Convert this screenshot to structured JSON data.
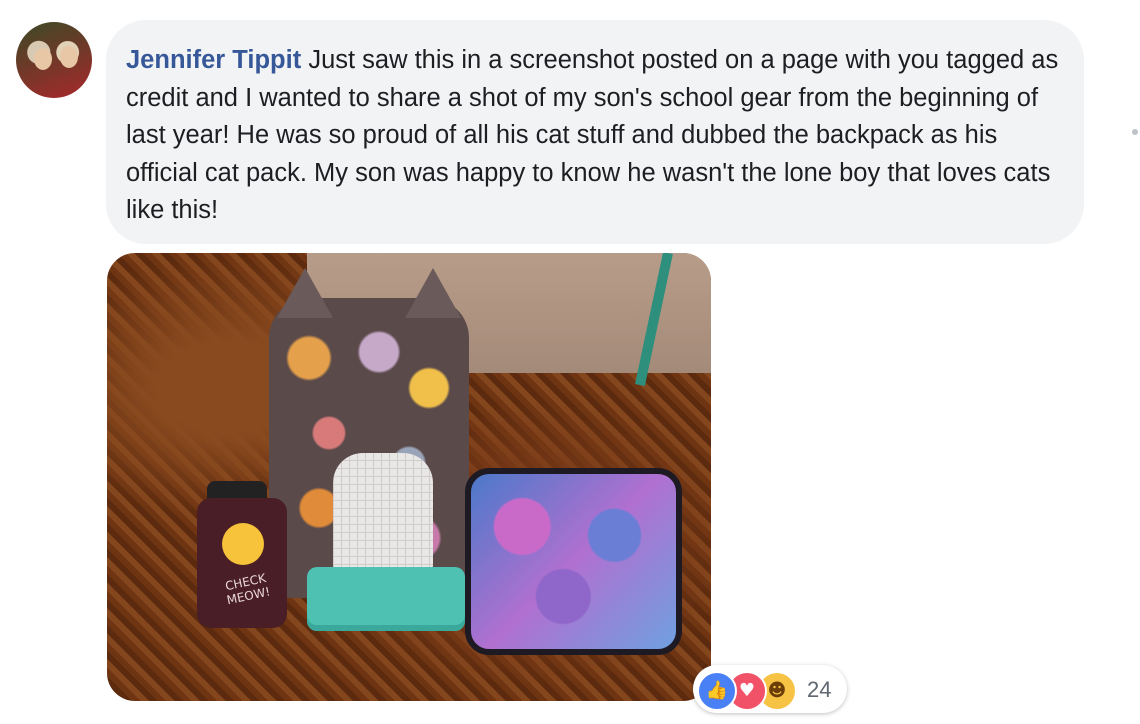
{
  "comment": {
    "author": "Jennifer Tippit",
    "text": "Just saw this in a screenshot posted on a page with you tagged as credit and I wanted to share a shot of my son's school gear from the beginning of last year! He was so proud of all his cat stuff and dubbed the backpack as his official cat pack. My son was happy to know he wasn't the lone boy that loves cats like this!"
  },
  "photo": {
    "bottle_text": "CHECK MEOW!"
  },
  "reactions": {
    "icons": [
      "like-icon",
      "love-icon",
      "haha-icon"
    ],
    "count": "24"
  },
  "colors": {
    "author_link": "#365899",
    "bubble_bg": "#f2f3f5",
    "like": "#4a80f5",
    "love": "#f25268",
    "haha": "#f7c344"
  }
}
